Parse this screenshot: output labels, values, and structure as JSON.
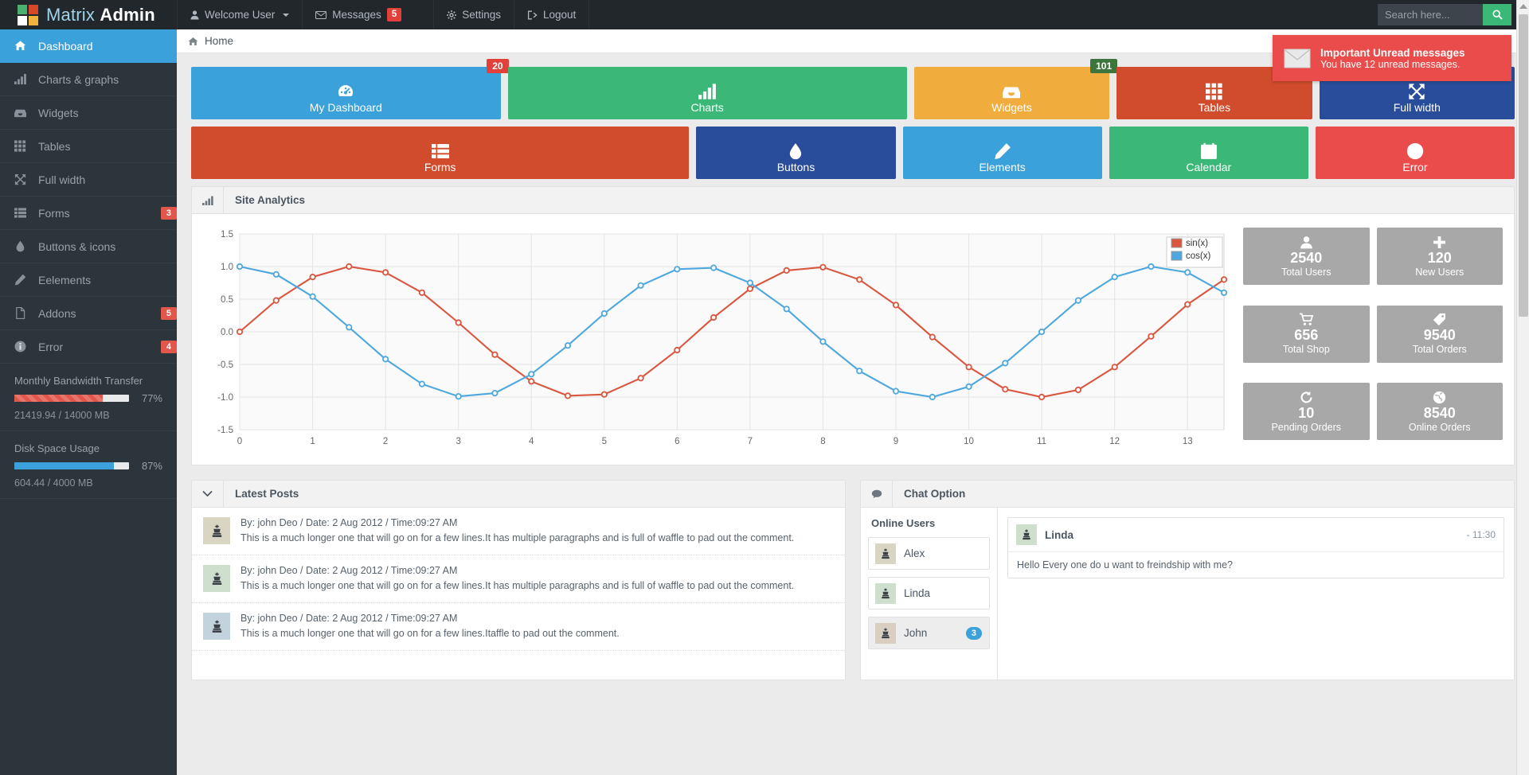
{
  "brand": {
    "light": "Matrix",
    "bold": "Admin",
    "logo_colors": [
      "#4caf72",
      "#d9472b",
      "#ffffff",
      "#f2b33d"
    ]
  },
  "topnav": {
    "items": [
      {
        "label": "Welcome User",
        "icon": "user-icon",
        "caret": true
      },
      {
        "label": "Messages",
        "icon": "envelope-icon",
        "badge": "5",
        "split_caret": true
      },
      {
        "label": "Settings",
        "icon": "gear-icon"
      },
      {
        "label": "Logout",
        "icon": "signout-icon"
      }
    ]
  },
  "search": {
    "placeholder": "Search here...",
    "value": "",
    "button_icon": "search-icon",
    "button_color": "#3bb878"
  },
  "breadcrumb": {
    "icon": "home-icon",
    "label": "Home"
  },
  "toast": {
    "icon": "envelope-icon",
    "title": "Important Unread messages",
    "subtitle": "You have 12 unread messages.",
    "color": "#ea4b4b"
  },
  "sidebar": {
    "items": [
      {
        "label": "Dashboard",
        "icon": "home-icon",
        "active": true,
        "badge": null
      },
      {
        "label": "Charts & graphs",
        "icon": "bars-icon",
        "active": false,
        "badge": null
      },
      {
        "label": "Widgets",
        "icon": "inbox-icon",
        "active": false,
        "badge": null
      },
      {
        "label": "Tables",
        "icon": "grid-icon",
        "active": false,
        "badge": null
      },
      {
        "label": "Full width",
        "icon": "expand-icon",
        "active": false,
        "badge": null
      },
      {
        "label": "Forms",
        "icon": "list-icon",
        "active": false,
        "badge": "3"
      },
      {
        "label": "Buttons & icons",
        "icon": "droplet-icon",
        "active": false,
        "badge": null
      },
      {
        "label": "Eelements",
        "icon": "pencil-icon",
        "active": false,
        "badge": null
      },
      {
        "label": "Addons",
        "icon": "file-icon",
        "active": false,
        "badge": "5"
      },
      {
        "label": "Error",
        "icon": "info-icon",
        "active": false,
        "badge": "4"
      }
    ],
    "meters": [
      {
        "label": "Monthly Bandwidth Transfer",
        "percent": "77%",
        "fill": 77,
        "sub": "21419.94 / 14000 MB",
        "color": "#e2574c",
        "style": "striped"
      },
      {
        "label": "Disk Space Usage",
        "percent": "87%",
        "fill": 87,
        "sub": "604.44 / 4000 MB",
        "color": "#3ba1db",
        "style": "solid"
      }
    ]
  },
  "tiles_row1": [
    {
      "label": "My Dashboard",
      "icon": "dashboard-icon",
      "color": "#3ba1db",
      "flex": 190,
      "badge": "20",
      "badge_color": "#e2403a"
    },
    {
      "label": "Charts",
      "icon": "bars-icon",
      "color": "#3bb878",
      "flex": 245,
      "badge": null,
      "badge_color": null
    },
    {
      "label": "Widgets",
      "icon": "inbox-icon",
      "color": "#f0ad3e",
      "flex": 120,
      "badge": "101",
      "badge_color": "#3c763d"
    },
    {
      "label": "Tables",
      "icon": "grid-icon",
      "color": "#d14c2c",
      "flex": 120,
      "badge": null,
      "badge_color": null
    },
    {
      "label": "Full width",
      "icon": "expand-icon",
      "color": "#2a4d9b",
      "flex": 120,
      "badge": null,
      "badge_color": null
    }
  ],
  "tiles_row2": [
    {
      "label": "Forms",
      "icon": "list-icon",
      "color": "#d14c2c",
      "flex": 300
    },
    {
      "label": "Buttons",
      "icon": "droplet-icon",
      "color": "#2a4d9b",
      "flex": 120
    },
    {
      "label": "Elements",
      "icon": "pencil-icon",
      "color": "#3ba1db",
      "flex": 120
    },
    {
      "label": "Calendar",
      "icon": "calendar-icon",
      "color": "#3bb878",
      "flex": 120
    },
    {
      "label": "Error",
      "icon": "info-icon",
      "color": "#ea4b4b",
      "flex": 120
    }
  ],
  "analytics": {
    "title": "Site Analytics",
    "icon": "bars-icon",
    "stats": [
      {
        "value": "2540",
        "label": "Total Users",
        "icon": "user-icon"
      },
      {
        "value": "120",
        "label": "New Users",
        "icon": "plus-icon"
      },
      {
        "value": "656",
        "label": "Total Shop",
        "icon": "cart-icon"
      },
      {
        "value": "9540",
        "label": "Total Orders",
        "icon": "tag-icon"
      },
      {
        "value": "10",
        "label": "Pending Orders",
        "icon": "refresh-icon"
      },
      {
        "value": "8540",
        "label": "Online Orders",
        "icon": "globe-icon"
      }
    ]
  },
  "chart_data": {
    "type": "line",
    "title": "Site Analytics",
    "xlabel": "",
    "ylabel": "",
    "xlim": [
      0,
      13.5
    ],
    "ylim": [
      -1.5,
      1.5
    ],
    "xticks": [
      0,
      1,
      2,
      3,
      4,
      5,
      6,
      7,
      8,
      9,
      10,
      11,
      12,
      13
    ],
    "yticks": [
      -1.5,
      -1.0,
      -0.5,
      0.0,
      0.5,
      1.0,
      1.5
    ],
    "ytick_labels": [
      "-1.5",
      "-1.0",
      "-0.5",
      "0.0",
      "0.5",
      "1.0",
      "1.5"
    ],
    "grid": true,
    "legend_position": "top-right",
    "markers": "circle",
    "x": [
      0,
      0.5,
      1,
      1.5,
      2,
      2.5,
      3,
      3.5,
      4,
      4.5,
      5,
      5.5,
      6,
      6.5,
      7,
      7.5,
      8,
      8.5,
      9,
      9.5,
      10,
      10.5,
      11,
      11.5,
      12,
      12.5,
      13,
      13.5
    ],
    "series": [
      {
        "name": "sin(x)",
        "color": "#d9563f",
        "values": [
          0.0,
          0.48,
          0.84,
          1.0,
          0.91,
          0.6,
          0.14,
          -0.35,
          -0.76,
          -0.98,
          -0.96,
          -0.71,
          -0.28,
          0.22,
          0.66,
          0.94,
          0.99,
          0.8,
          0.41,
          -0.08,
          -0.54,
          -0.88,
          -1.0,
          -0.89,
          -0.54,
          -0.07,
          0.42,
          0.8
        ]
      },
      {
        "name": "cos(x)",
        "color": "#4ea8dd",
        "values": [
          1.0,
          0.88,
          0.54,
          0.07,
          -0.42,
          -0.8,
          -0.99,
          -0.94,
          -0.65,
          -0.21,
          0.28,
          0.71,
          0.96,
          0.98,
          0.75,
          0.35,
          -0.15,
          -0.6,
          -0.91,
          -1.0,
          -0.84,
          -0.48,
          0.0,
          0.48,
          0.84,
          1.0,
          0.91,
          0.6
        ]
      }
    ]
  },
  "latest_posts": {
    "title": "Latest Posts",
    "icon": "chevron-down-icon",
    "posts": [
      {
        "meta": "By: john Deo / Date: 2 Aug 2012 / Time:09:27 AM",
        "text": "This is a much longer one that will go on for a few lines.It has multiple paragraphs and is full of waffle to pad out the comment.",
        "avatar_color": "#d9d5c3",
        "avatar_icon": "chess-king-icon"
      },
      {
        "meta": "By: john Deo / Date: 2 Aug 2012 / Time:09:27 AM",
        "text": "This is a much longer one that will go on for a few lines.It has multiple paragraphs and is full of waffle to pad out the comment.",
        "avatar_color": "#cedfce",
        "avatar_icon": "chess-king-icon"
      },
      {
        "meta": "By: john Deo / Date: 2 Aug 2012 / Time:09:27 AM",
        "text": "This is a much longer one that will go on for a few lines.Itaffle to pad out the comment.",
        "avatar_color": "#c3d3de",
        "avatar_icon": "chess-king-icon"
      }
    ]
  },
  "chat": {
    "title": "Chat Option",
    "icon": "comment-icon",
    "online_title": "Online Users",
    "users": [
      {
        "name": "Alex",
        "avatar_color": "#d9d5c3",
        "badge": null,
        "selected": false
      },
      {
        "name": "Linda",
        "avatar_color": "#cedfce",
        "badge": null,
        "selected": false
      },
      {
        "name": "John",
        "avatar_color": "#d9cfc0",
        "badge": "3",
        "selected": true
      }
    ],
    "message": {
      "name": "Linda",
      "time": "- 11:30",
      "text": "Hello Every one do u want to freindship with me?",
      "avatar_color": "#cedfce"
    }
  }
}
